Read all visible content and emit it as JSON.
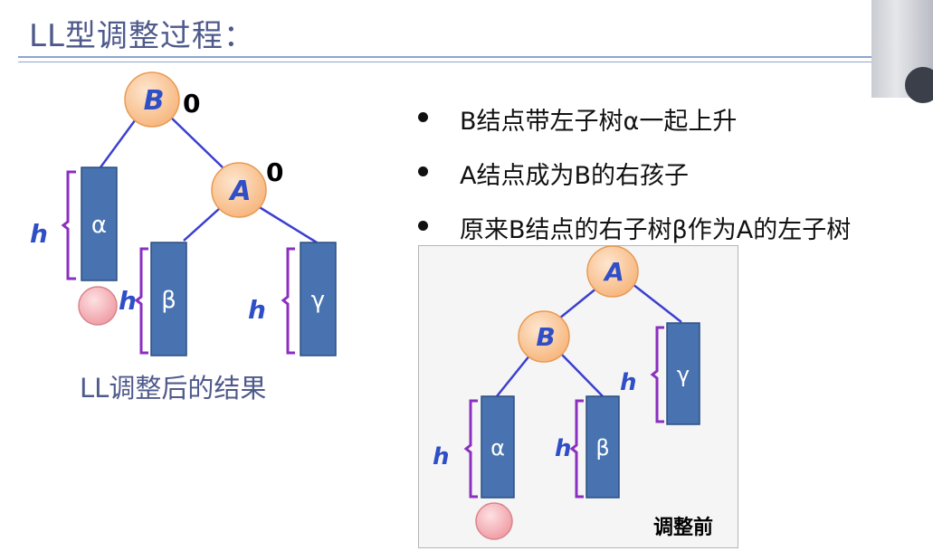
{
  "title": "LL型调整过程：",
  "bullets": [
    "B结点带左子树α一起上升",
    "A结点成为B的右孩子",
    "原来B结点的右子树β作为A的左子树"
  ],
  "after": {
    "caption": "LL调整后的结果",
    "node_b": "B",
    "node_a": "A",
    "balance_b": "0",
    "balance_a": "0",
    "subtree_alpha": "α",
    "subtree_beta": "β",
    "subtree_gamma": "γ",
    "height_label": "h"
  },
  "before": {
    "label": "调整前",
    "node_a": "A",
    "node_b": "B",
    "subtree_alpha": "α",
    "subtree_beta": "β",
    "subtree_gamma": "γ",
    "height_label": "h"
  },
  "colors": {
    "node_fill": "#fbc495",
    "node_stroke": "#e79b55",
    "node_text": "#2f4fc7",
    "subtree_fill": "#4873b0",
    "subtree_stroke": "#2c4f82",
    "edge": "#3b3fd0",
    "brace": "#8b2fc1",
    "h_label": "#2f4fc7",
    "inserted": "#f1a1a8"
  }
}
